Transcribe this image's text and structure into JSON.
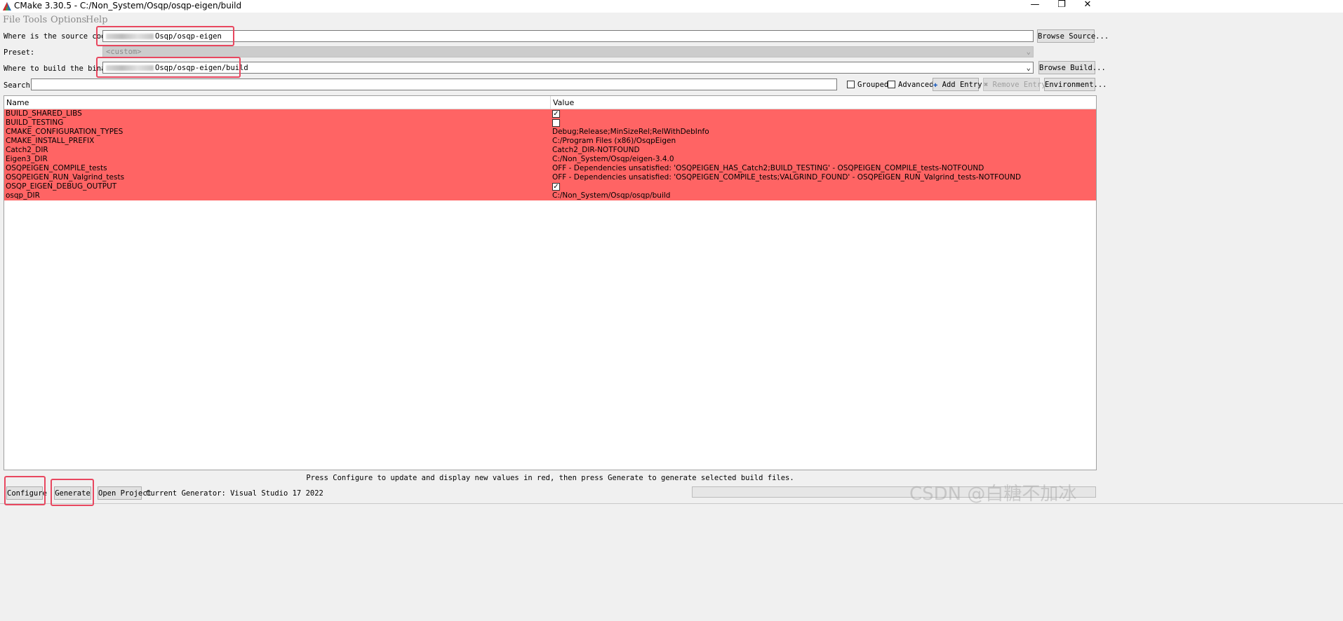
{
  "window": {
    "title": "CMake 3.30.5 - C:/Non_System/Osqp/osqp-eigen/build",
    "controls": {
      "minimize": "—",
      "restore": "❐",
      "close": "✕"
    }
  },
  "menu": [
    "File",
    "Tools",
    "Options",
    "Help"
  ],
  "source": {
    "label": "Where is the source code:",
    "value": "Osqp/osqp-eigen",
    "browse": "Browse Source..."
  },
  "preset": {
    "label": "Preset:",
    "value": "<custom>"
  },
  "build": {
    "label": "Where to build the binaries:",
    "value": "Osqp/osqp-eigen/build",
    "browse": "Browse Build..."
  },
  "search": {
    "label": "Search:",
    "value": "",
    "grouped": "Grouped",
    "advanced": "Advanced",
    "add_entry": "Add Entry",
    "remove_entry": "Remove Entry",
    "environment": "Environment..."
  },
  "table": {
    "headers": {
      "name": "Name",
      "value": "Value"
    },
    "rows": [
      {
        "name": "BUILD_SHARED_LIBS",
        "value": "",
        "checkbox": true,
        "checked": true
      },
      {
        "name": "BUILD_TESTING",
        "value": "",
        "checkbox": true,
        "checked": false
      },
      {
        "name": "CMAKE_CONFIGURATION_TYPES",
        "value": "Debug;Release;MinSizeRel;RelWithDebInfo"
      },
      {
        "name": "CMAKE_INSTALL_PREFIX",
        "value": "C:/Program Files (x86)/OsqpEigen"
      },
      {
        "name": "Catch2_DIR",
        "value": "Catch2_DIR-NOTFOUND"
      },
      {
        "name": "Eigen3_DIR",
        "value": "C:/Non_System/Osqp/eigen-3.4.0"
      },
      {
        "name": "OSQPEIGEN_COMPILE_tests",
        "value": "OFF - Dependencies unsatisfied: 'OSQPEIGEN_HAS_Catch2;BUILD_TESTING' - OSQPEIGEN_COMPILE_tests-NOTFOUND"
      },
      {
        "name": "OSQPEIGEN_RUN_Valgrind_tests",
        "value": "OFF - Dependencies unsatisfied: 'OSQPEIGEN_COMPILE_tests;VALGRIND_FOUND' - OSQPEIGEN_RUN_Valgrind_tests-NOTFOUND"
      },
      {
        "name": "OSQP_EIGEN_DEBUG_OUTPUT",
        "value": "",
        "checkbox": true,
        "checked": true
      },
      {
        "name": "osqp_DIR",
        "value": "C:/Non_System/Osqp/osqp/build"
      }
    ],
    "highlight_color": "#ff6464"
  },
  "footer": {
    "message": "Press Configure to update and display new values in red, then press Generate to generate selected build files.",
    "configure": "Configure",
    "generate": "Generate",
    "open_project": "Open Project",
    "generator": "Current Generator: Visual Studio 17 2022"
  },
  "watermark": "CSDN @白糖不加冰",
  "annotation_color": "#e8475f"
}
